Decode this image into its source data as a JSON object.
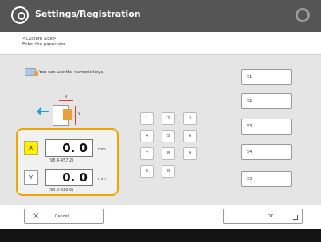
{
  "titlebar": {
    "title": "Settings/Registration"
  },
  "subheader": {
    "line1": "<Custom Size>",
    "line2": "Enter the paper size."
  },
  "hint": {
    "text": "You can use the numeric keys."
  },
  "diagram": {
    "x_label": "X",
    "y_label": "Y"
  },
  "inputs": {
    "x": {
      "label": "X",
      "value": "0. 0",
      "unit": "mm",
      "range": "(98.4-457.2)"
    },
    "y": {
      "label": "Y",
      "value": "0. 0",
      "unit": "mm",
      "range": "(98.0-320.0)"
    }
  },
  "keypad": {
    "keys": [
      "1",
      "2",
      "3",
      "4",
      "5",
      "6",
      "7",
      "8",
      "9",
      "C",
      "0"
    ]
  },
  "sizes": [
    "S1",
    "S2",
    "S3",
    "S4",
    "S5"
  ],
  "actions": {
    "cancel": "Cancel",
    "ok": "OK"
  }
}
